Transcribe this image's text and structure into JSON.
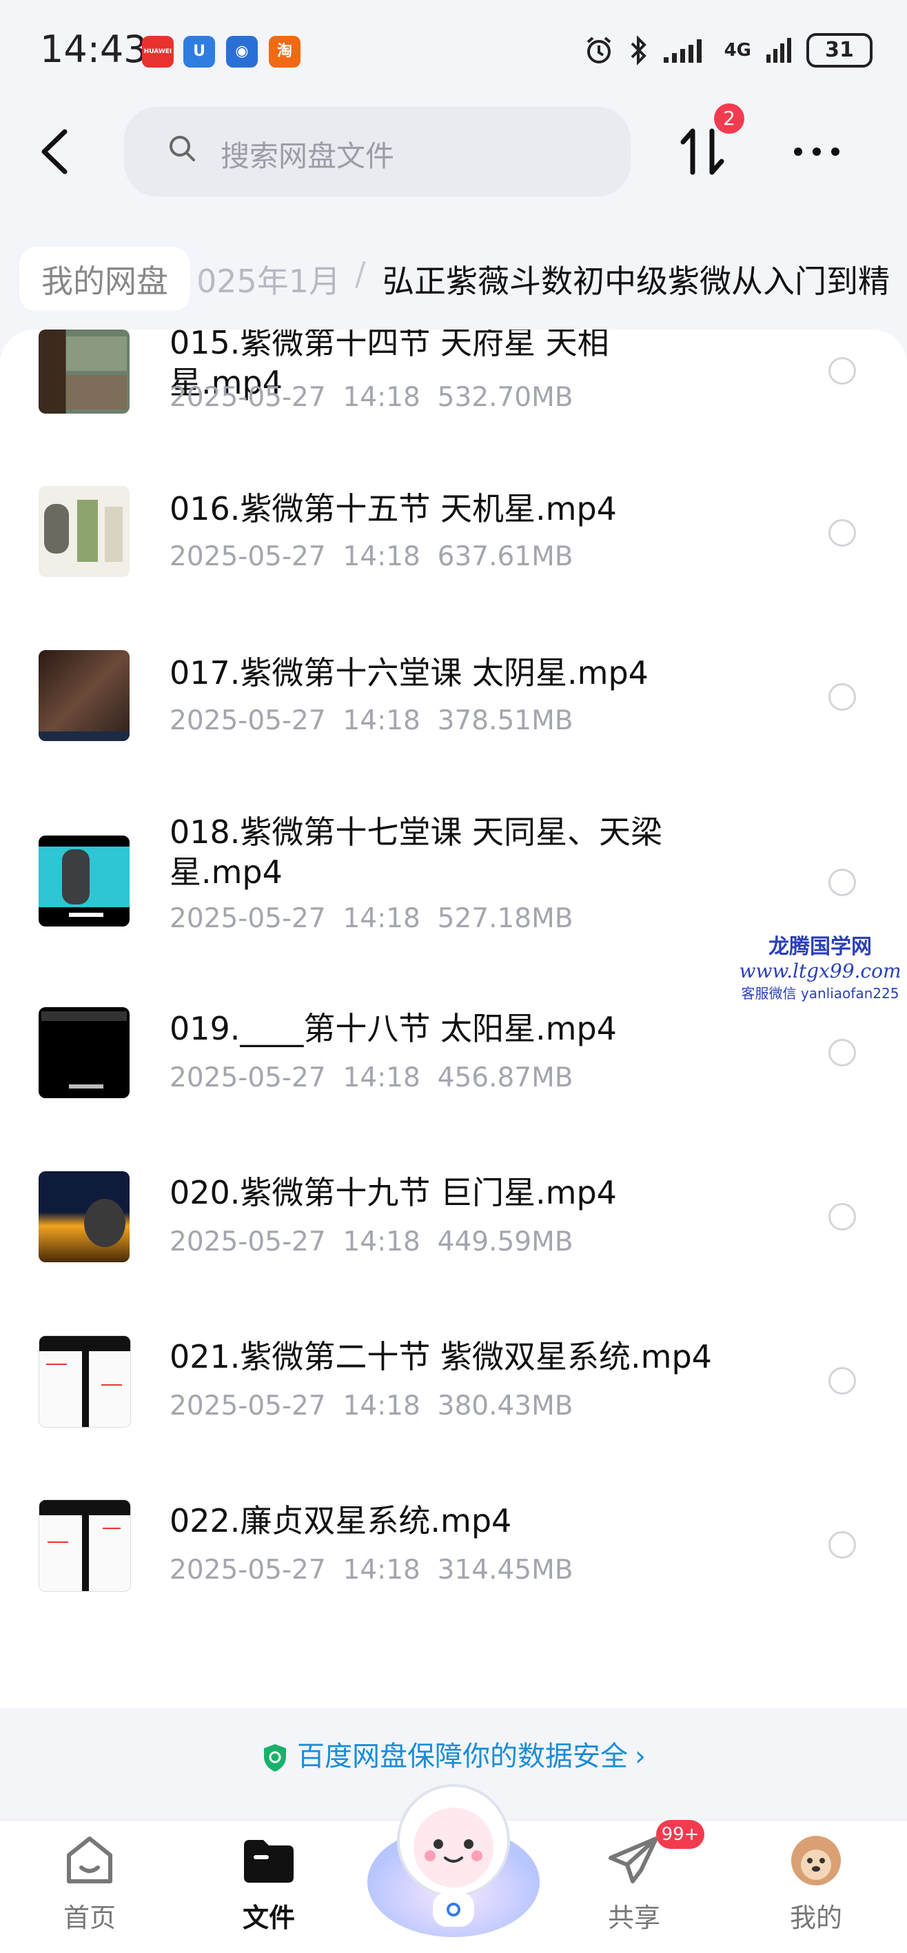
{
  "status_bar": {
    "time": "14:43",
    "app_icons": [
      {
        "name": "huawei-icon",
        "text": "HUAWEI",
        "color": "#e8322f"
      },
      {
        "name": "app-u-icon",
        "text": "U",
        "color": "#2f7de1"
      },
      {
        "name": "app-blue-icon",
        "text": "◉",
        "color": "#2a6fd6"
      },
      {
        "name": "taobao-icon",
        "text": "淘",
        "color": "#f06a14"
      }
    ],
    "network": "4G",
    "battery": "31"
  },
  "header": {
    "search_placeholder": "搜索网盘文件",
    "transfer_badge": "2"
  },
  "breadcrumb": {
    "root": "我的网盘",
    "middle": "025年1月",
    "separator": "/",
    "current": "弘正紫薇斗数初中级紫微从入门到精"
  },
  "files": [
    {
      "name": "015.紫微第十四节 天府星 天相星.mp4",
      "date": "2025-05-27",
      "time": "14:18",
      "size": "532.70MB"
    },
    {
      "name": "016.紫微第十五节 天机星.mp4",
      "date": "2025-05-27",
      "time": "14:18",
      "size": "637.61MB"
    },
    {
      "name": "017.紫微第十六堂课 太阴星.mp4",
      "date": "2025-05-27",
      "time": "14:18",
      "size": "378.51MB"
    },
    {
      "name": "018.紫微第十七堂课 天同星、天梁星.mp4",
      "date": "2025-05-27",
      "time": "14:18",
      "size": "527.18MB"
    },
    {
      "name": "019.____第十八节 太阳星.mp4",
      "date": "2025-05-27",
      "time": "14:18",
      "size": "456.87MB"
    },
    {
      "name": "020.紫微第十九节 巨门星.mp4",
      "date": "2025-05-27",
      "time": "14:18",
      "size": "449.59MB"
    },
    {
      "name": "021.紫微第二十节 紫微双星系统.mp4",
      "date": "2025-05-27",
      "time": "14:18",
      "size": "380.43MB"
    },
    {
      "name": "022.廉贞双星系统.mp4",
      "date": "2025-05-27",
      "time": "14:18",
      "size": "314.45MB"
    }
  ],
  "watermark": {
    "line1": "龙腾国学网",
    "line2": "www.ltgx99.com",
    "line3": "客服微信 yanliaofan225"
  },
  "security_banner": "百度网盘保障你的数据安全",
  "nav": {
    "home": "首页",
    "files": "文件",
    "share": "共享",
    "share_badge": "99+",
    "mine": "我的"
  }
}
